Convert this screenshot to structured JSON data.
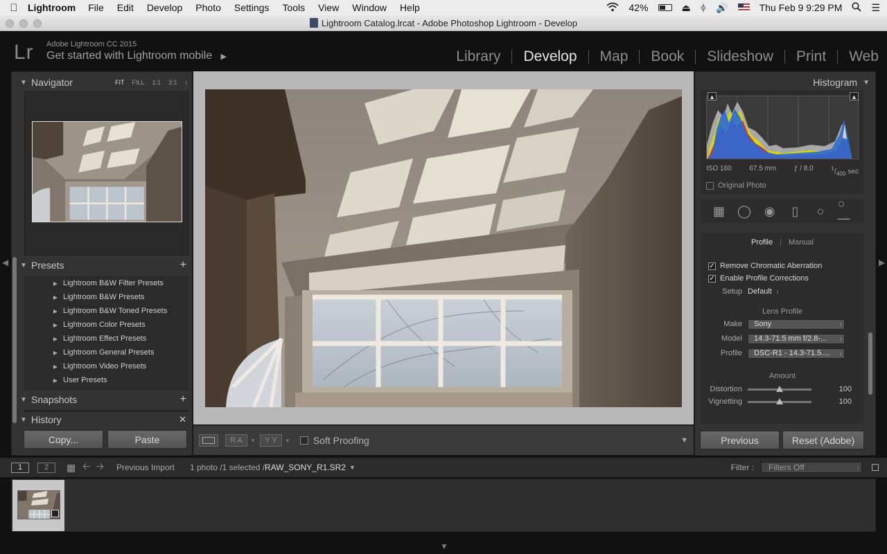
{
  "menubar": {
    "app_name": "Lightroom",
    "items": [
      "File",
      "Edit",
      "Develop",
      "Photo",
      "Settings",
      "Tools",
      "View",
      "Window",
      "Help"
    ],
    "battery": "42%",
    "clock": "Thu Feb 9  9:29 PM"
  },
  "window": {
    "title": "Lightroom Catalog.lrcat - Adobe Photoshop Lightroom - Develop"
  },
  "identity": {
    "logo": "Lr",
    "product": "Adobe Lightroom CC 2015",
    "mobile_link": "Get started with Lightroom mobile"
  },
  "modules": [
    "Library",
    "Develop",
    "Map",
    "Book",
    "Slideshow",
    "Print",
    "Web"
  ],
  "active_module": "Develop",
  "left_panel": {
    "navigator": {
      "title": "Navigator",
      "zoom_options": [
        "FIT",
        "FILL",
        "1:1",
        "3:1"
      ],
      "active_zoom": "FIT"
    },
    "presets": {
      "title": "Presets",
      "items": [
        "Lightroom B&W Filter Presets",
        "Lightroom B&W Presets",
        "Lightroom B&W Toned Presets",
        "Lightroom Color Presets",
        "Lightroom Effect Presets",
        "Lightroom General Presets",
        "Lightroom Video Presets",
        "User Presets"
      ]
    },
    "snapshots_title": "Snapshots",
    "history_title": "History",
    "copy_button": "Copy...",
    "paste_button": "Paste"
  },
  "toolbar": {
    "soft_proofing": "Soft Proofing",
    "ra_label": "R A",
    "yy_label": "Y Y"
  },
  "right_panel": {
    "histogram_title": "Histogram",
    "exif": {
      "iso": "ISO 160",
      "focal": "67.5 mm",
      "aperture": "ƒ / 8.0",
      "shutter_num": "1",
      "shutter_den": "400",
      "shutter_unit": "sec"
    },
    "original_photo": "Original Photo",
    "lens": {
      "tab_profile": "Profile",
      "tab_manual": "Manual",
      "remove_ca": "Remove Chromatic Aberration",
      "enable_profile": "Enable Profile Corrections",
      "setup_label": "Setup",
      "setup_value": "Default",
      "lens_profile_title": "Lens Profile",
      "make_label": "Make",
      "make_value": "Sony",
      "model_label": "Model",
      "model_value": "14.3-71.5 mm f/2.8-...",
      "profile_label": "Profile",
      "profile_value": "DSC-R1 - 14.3-71.5....",
      "amount_title": "Amount",
      "distortion_label": "Distortion",
      "distortion_value": "100",
      "vignetting_label": "Vignetting",
      "vignetting_value": "100"
    },
    "previous_button": "Previous",
    "reset_button": "Reset (Adobe)"
  },
  "filmstrip": {
    "screen1": "1",
    "screen2": "2",
    "source": "Previous Import",
    "count": "1 photo /1 selected /",
    "filename": "RAW_SONY_R1.SR2",
    "filter_label": "Filter :",
    "filter_value": "Filters Off"
  }
}
